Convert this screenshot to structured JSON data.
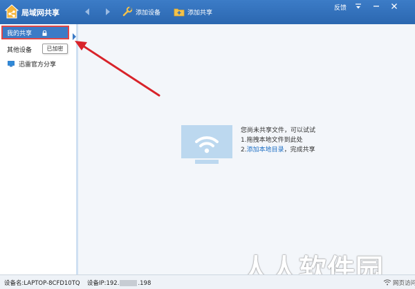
{
  "app": {
    "title": "局域网共享"
  },
  "toolbar": {
    "add_device_label": "添加设备",
    "add_share_label": "添加共享"
  },
  "window": {
    "feedback_label": "反馈"
  },
  "sidebar": {
    "my_share_label": "我的共享",
    "other_devices_label": "其他设备",
    "tooltip_text": "已加密",
    "devices": [
      {
        "label": "迅雷官方分享"
      }
    ]
  },
  "empty_state": {
    "line1": "您尚未共享文件，可以试试",
    "line2": "1.拖拽本地文件到此处",
    "line3_prefix": "2.",
    "line3_link": "添加本地目录",
    "line3_suffix": "，完成共享"
  },
  "watermark": {
    "text": "人人软件园"
  },
  "statusbar": {
    "device_name": "设备名:LAPTOP-8CFD10TQ",
    "ip_prefix": "设备IP:192.",
    "ip_suffix": ".198",
    "web_access": "网页访问地址"
  },
  "colors": {
    "titlebar": "#2f6db8",
    "selection": "#3c7bc6",
    "highlight_border": "#e04646",
    "link": "#1e6fc4",
    "arrow": "#d8232a"
  },
  "icons": {
    "app_logo": "home-share-icon",
    "back": "chevron-left-icon",
    "forward": "chevron-right-icon",
    "add_device": "wrench-icon",
    "add_share": "folder-plus-icon",
    "lock": "lock-icon",
    "device": "monitor-icon",
    "empty": "wifi-monitor-icon"
  }
}
